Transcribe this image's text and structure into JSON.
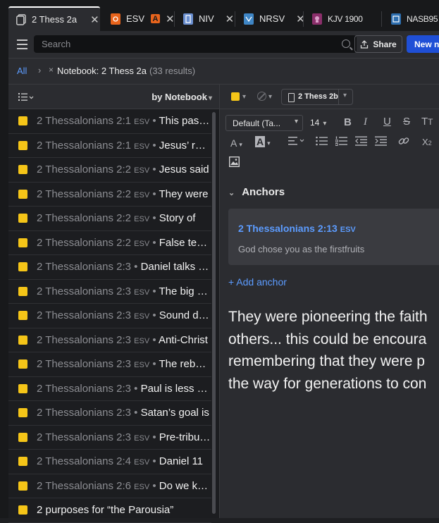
{
  "tabs": [
    {
      "label": "2 Thess 2a",
      "icon": "notes-icon",
      "active": true
    },
    {
      "label": "ESV",
      "icon": "esv-icon",
      "badge": "A"
    },
    {
      "label": "NIV",
      "icon": "niv-icon"
    },
    {
      "label": "NRSV",
      "icon": "nrsv-icon"
    },
    {
      "label": "KJV 1900",
      "icon": "kjv-icon"
    },
    {
      "label": "NASB95",
      "icon": "nasb-icon"
    }
  ],
  "toolbar": {
    "search_placeholder": "Search",
    "share_label": "Share",
    "new_label": "New no"
  },
  "breadcrumb": {
    "all": "All",
    "chevron": "›",
    "remove": "×",
    "notebook": "Notebook: 2 Thess 2a",
    "count": "(33 results)"
  },
  "list_header": {
    "sort_label": "by Notebook"
  },
  "notes": [
    {
      "ref": "2 Thessalonians 2:1",
      "version": "ESV",
      "text": "This passage"
    },
    {
      "ref": "2 Thessalonians 2:1",
      "version": "ESV",
      "text": "Jesus’ return"
    },
    {
      "ref": "2 Thessalonians 2:2",
      "version": "ESV",
      "text": "Jesus said"
    },
    {
      "ref": "2 Thessalonians 2:2",
      "version": "ESV",
      "text": "They were"
    },
    {
      "ref": "2 Thessalonians 2:2",
      "version": "ESV",
      "text": "Story of"
    },
    {
      "ref": "2 Thessalonians 2:2",
      "version": "ESV",
      "text": "False teaching"
    },
    {
      "ref": "2 Thessalonians 2:3",
      "version": "",
      "text": "Daniel talks about"
    },
    {
      "ref": "2 Thessalonians 2:3",
      "version": "ESV",
      "text": "The big picture"
    },
    {
      "ref": "2 Thessalonians 2:3",
      "version": "ESV",
      "text": "Sound doctrine"
    },
    {
      "ref": "2 Thessalonians 2:3",
      "version": "ESV",
      "text": "Anti-Christ"
    },
    {
      "ref": "2 Thessalonians 2:3",
      "version": "ESV",
      "text": "The rebellion"
    },
    {
      "ref": "2 Thessalonians 2:3",
      "version": "",
      "text": "Paul is less concerned"
    },
    {
      "ref": "2 Thessalonians 2:3",
      "version": "",
      "text": "Satan’s goal is"
    },
    {
      "ref": "2 Thessalonians 2:3",
      "version": "ESV",
      "text": "Pre-tribulation"
    },
    {
      "ref": "2 Thessalonians 2:4",
      "version": "ESV",
      "text": "Daniel 11"
    },
    {
      "ref": "2 Thessalonians 2:6",
      "version": "ESV",
      "text": "Do we know"
    },
    {
      "ref": "",
      "version": "",
      "text": "2 purposes for “the Parousia”"
    }
  ],
  "editor": {
    "notebook_chip": "2 Thess 2b",
    "font": "Default (Ta...",
    "size": "14",
    "anchors_heading": "Anchors",
    "anchor_ref": "2 Thessalonians 2:13",
    "anchor_version": "ESV",
    "anchor_text": "God chose you as the firstfruits",
    "add_anchor": "+ Add anchor",
    "body_lines": [
      "They were pioneering the faith",
      "others... this could be encoura",
      "remembering that they were p",
      "the way for generations to con"
    ]
  },
  "colors": {
    "accent": "#5c9cff",
    "note_yellow": "#f5c518",
    "primary_button": "#1f4fd6"
  }
}
